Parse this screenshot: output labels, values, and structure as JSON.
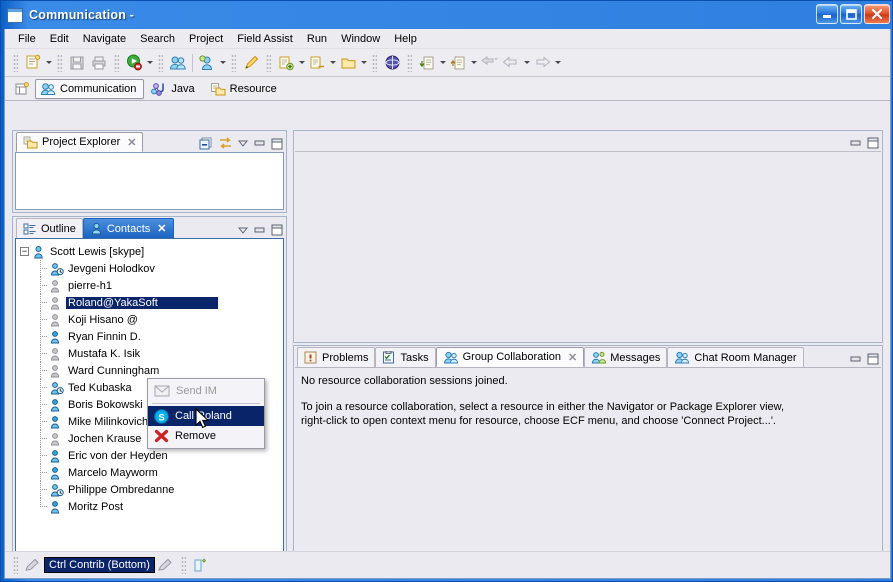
{
  "window": {
    "title": "Communication -",
    "icon": "app-window-icon",
    "buttons": {
      "minimize": "Minimize",
      "maximize": "Maximize",
      "close": "Close"
    }
  },
  "menubar": {
    "items": [
      "File",
      "Edit",
      "Navigate",
      "Search",
      "Project",
      "Field Assist",
      "Run",
      "Window",
      "Help"
    ]
  },
  "toolbar": {
    "groups": [
      {
        "items": [
          {
            "icon": "new-wizard-icon",
            "arrow": true
          }
        ]
      },
      {
        "items": [
          {
            "icon": "save-icon",
            "arrow": false
          },
          {
            "icon": "print-icon",
            "arrow": false
          }
        ]
      },
      {
        "items": [
          {
            "icon": "run-icon",
            "arrow": true
          }
        ]
      },
      {
        "items": [
          {
            "icon": "group-users-icon",
            "arrow": false
          },
          {
            "icon": "add-user-icon",
            "arrow": true
          }
        ]
      },
      {
        "items": [
          {
            "icon": "pencil-icon",
            "arrow": false
          }
        ]
      },
      {
        "items": [
          {
            "icon": "new-package-icon",
            "arrow": true
          },
          {
            "icon": "new-class-icon",
            "arrow": true
          },
          {
            "icon": "new-folder-icon",
            "arrow": true
          }
        ]
      },
      {
        "items": [
          {
            "icon": "globe-icon",
            "arrow": false
          }
        ]
      },
      {
        "items": [
          {
            "icon": "import-icon",
            "arrow": true
          },
          {
            "icon": "export-icon",
            "arrow": true
          }
        ]
      },
      {
        "items": [
          {
            "icon": "back-history-icon",
            "arrow": false
          },
          {
            "icon": "back-arrow-icon",
            "arrow": true
          },
          {
            "icon": "forward-arrow-icon",
            "arrow": true
          }
        ]
      }
    ]
  },
  "perspectives": {
    "open_icon": "open-perspective-icon",
    "tabs": [
      {
        "label": "Communication",
        "icon": "communication-icon",
        "active": true
      },
      {
        "label": "Java",
        "icon": "java-icon",
        "active": false
      },
      {
        "label": "Resource",
        "icon": "resource-icon",
        "active": false
      }
    ]
  },
  "project_explorer": {
    "tab_label": "Project Explorer",
    "tab_icon": "project-explorer-icon",
    "tools": [
      "collapse-all-icon",
      "link-with-editor-icon",
      "view-menu-icon",
      "minimize-icon",
      "maximize-icon"
    ],
    "content": ""
  },
  "contacts_view": {
    "tabs": [
      {
        "label": "Outline",
        "icon": "outline-icon",
        "active": false
      },
      {
        "label": "Contacts",
        "icon": "contacts-icon",
        "active": true,
        "closable": true
      }
    ],
    "tools": [
      "view-menu-icon",
      "minimize-icon",
      "maximize-icon"
    ],
    "root": {
      "label": "Scott Lewis [skype]",
      "status": "online",
      "expanded": true
    },
    "children": [
      {
        "label": "Jevgeni Holodkov",
        "status": "away"
      },
      {
        "label": "pierre-h1",
        "status": "offline"
      },
      {
        "label": "Roland@YakaSoft",
        "status": "offline",
        "selected": true
      },
      {
        "label": "Koji Hisano @",
        "status": "offline"
      },
      {
        "label": "Ryan Finnin D.",
        "status": "online"
      },
      {
        "label": "Mustafa K. Isik",
        "status": "offline"
      },
      {
        "label": "Ward Cunningham",
        "status": "offline"
      },
      {
        "label": "Ted Kubaska",
        "status": "away"
      },
      {
        "label": "Boris Bokowski",
        "status": "online"
      },
      {
        "label": "Mike Milinkovich",
        "status": "online"
      },
      {
        "label": "Jochen Krause",
        "status": "offline"
      },
      {
        "label": "Eric von der Heyden",
        "status": "online"
      },
      {
        "label": "Marcelo Mayworm",
        "status": "online"
      },
      {
        "label": "Philippe Ombredanne",
        "status": "away"
      },
      {
        "label": "Moritz Post",
        "status": "online"
      }
    ]
  },
  "context_menu": {
    "items": [
      {
        "label": "Send IM",
        "icon": "envelope-icon",
        "state": "disabled"
      },
      {
        "separator": true
      },
      {
        "label": "Call Roland",
        "icon": "skype-icon",
        "state": "highlighted"
      },
      {
        "label": "Remove",
        "icon": "red-x-icon",
        "state": "normal"
      }
    ]
  },
  "editor_area": {
    "tools": [
      "minimize-icon",
      "maximize-icon"
    ],
    "content": ""
  },
  "bottom_panel": {
    "tabs": [
      {
        "label": "Problems",
        "icon": "problems-icon",
        "active": false
      },
      {
        "label": "Tasks",
        "icon": "tasks-icon",
        "active": false
      },
      {
        "label": "Group Collaboration",
        "icon": "group-collaboration-icon",
        "active": true,
        "closable": true
      },
      {
        "label": "Messages",
        "icon": "messages-icon",
        "active": false
      },
      {
        "label": "Chat Room Manager",
        "icon": "chat-room-manager-icon",
        "active": false
      }
    ],
    "tools": [
      "minimize-icon",
      "maximize-icon"
    ],
    "body": {
      "line1": "No resource collaboration sessions joined.",
      "line2": "To join a resource collaboration, select a resource in either the Navigator or Package Explorer view,",
      "line3": "right-click to open context menu for resource, choose ECF menu, and choose 'Connect Project...'."
    }
  },
  "statusbar": {
    "left_icon": "edit-contrib-icon",
    "label": "Ctrl Contrib (Bottom)",
    "right_icon": "edit-contrib-icon",
    "trailing_icon": "insert-mode-icon"
  },
  "colors": {
    "titlebar_blue": "#1665d2",
    "selection_navy": "#0a246a",
    "active_tab_blue": "#1c63c2",
    "chrome_gray": "#eceaf1",
    "online_blue": "#2aa7e0",
    "offline_gray": "#b4b4b4"
  }
}
